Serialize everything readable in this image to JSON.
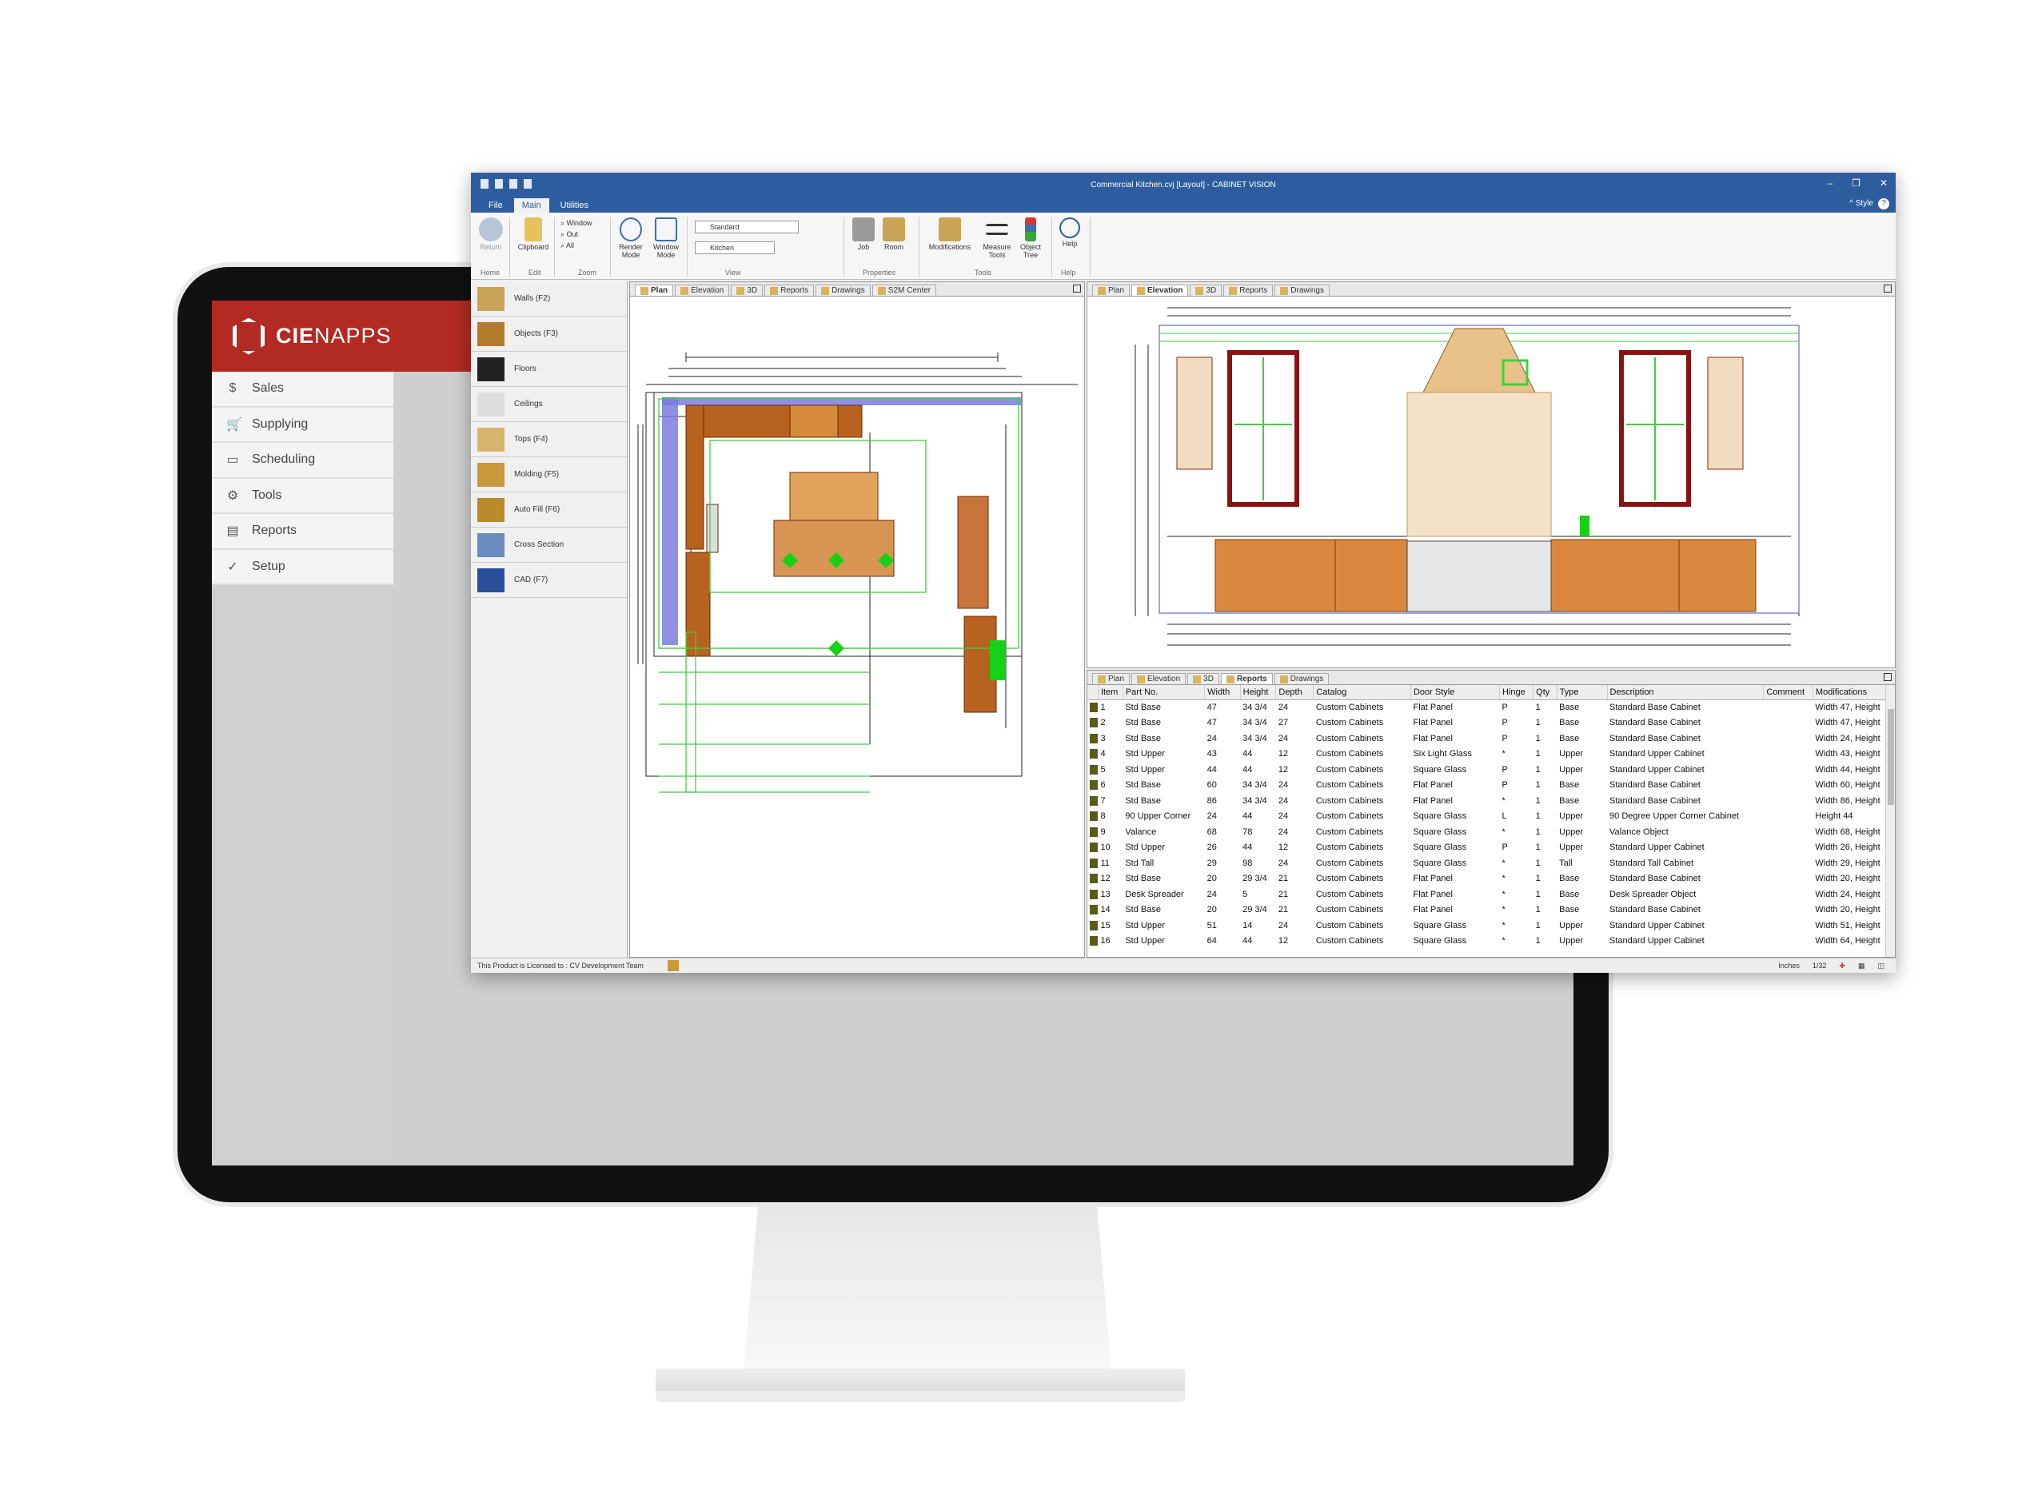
{
  "cienapps": {
    "brand_bold": "CIE",
    "brand_light": "NAPPS",
    "menu": [
      {
        "label": "Sales",
        "icon": "dollar-icon"
      },
      {
        "label": "Supplying",
        "icon": "cart-icon"
      },
      {
        "label": "Scheduling",
        "icon": "monitor-icon"
      },
      {
        "label": "Tools",
        "icon": "gear-icon"
      },
      {
        "label": "Reports",
        "icon": "document-icon"
      },
      {
        "label": "Setup",
        "icon": "check-circle-icon"
      }
    ]
  },
  "window": {
    "title": "Commercial Kitchen.cvj [Layout] - CABINET VISION",
    "menu": [
      "File",
      "Main",
      "Utilities"
    ],
    "active_menu": "Main",
    "style_label": "Style",
    "help_label": "?"
  },
  "ribbon": {
    "return_label": "Return",
    "clipboard_label": "Clipboard",
    "zoom_window": "Window",
    "zoom_out": "Out",
    "zoom_all": "All",
    "render_mode": "Render Mode",
    "window_mode": "Window Mode",
    "view_select": "Standard",
    "room_select": "Kitchen",
    "job_label": "Job",
    "room_label": "Room",
    "modifications_label": "Modifications",
    "measure_tools_label": "Measure Tools",
    "object_tree_label": "Object Tree",
    "help_label": "Help",
    "groups": {
      "home": "Home",
      "edit": "Edit",
      "zoom": "Zoom",
      "view": "View",
      "properties": "Properties",
      "tools": "Tools",
      "help": "Help"
    }
  },
  "left_panel": [
    {
      "label": "Walls (F2)",
      "color": "#c9a356"
    },
    {
      "label": "Objects (F3)",
      "color": "#b27a2a"
    },
    {
      "label": "Floors",
      "color": "#222222"
    },
    {
      "label": "Ceilings",
      "color": "#dddddd"
    },
    {
      "label": "Tops (F4)",
      "color": "#d8b46c"
    },
    {
      "label": "Molding (F5)",
      "color": "#c99a3c"
    },
    {
      "label": "Auto Fill (F6)",
      "color": "#b88a2a"
    },
    {
      "label": "Cross Section",
      "color": "#6a8cbf"
    },
    {
      "label": "CAD (F7)",
      "color": "#2a4f9a"
    }
  ],
  "plan_tabs": [
    "Plan",
    "Elevation",
    "3D",
    "Reports",
    "Drawings",
    "S2M Center"
  ],
  "elev_tabs": [
    "Plan",
    "Elevation",
    "3D",
    "Reports",
    "Drawings"
  ],
  "report_tabs": [
    "Plan",
    "Elevation",
    "3D",
    "Reports",
    "Drawings"
  ],
  "report": {
    "columns": [
      "Item",
      "Part No.",
      "Width",
      "Height",
      "Depth",
      "Catalog",
      "Door Style",
      "Hinge",
      "Qty",
      "Type",
      "Description",
      "Comment",
      "Modifications"
    ],
    "rows": [
      [
        "1",
        "Std Base",
        "47",
        "34 3/4",
        "24",
        "Custom Cabinets",
        "Flat Panel",
        "P",
        "1",
        "Base",
        "Standard Base Cabinet",
        "",
        "Width 47, Height"
      ],
      [
        "2",
        "Std Base",
        "47",
        "34 3/4",
        "27",
        "Custom Cabinets",
        "Flat Panel",
        "P",
        "1",
        "Base",
        "Standard Base Cabinet",
        "",
        "Width 47, Height"
      ],
      [
        "3",
        "Std Base",
        "24",
        "34 3/4",
        "24",
        "Custom Cabinets",
        "Flat Panel",
        "P",
        "1",
        "Base",
        "Standard Base Cabinet",
        "",
        "Width 24, Height"
      ],
      [
        "4",
        "Std Upper",
        "43",
        "44",
        "12",
        "Custom Cabinets",
        "Six Light Glass",
        "*",
        "1",
        "Upper",
        "Standard Upper Cabinet",
        "",
        "Width 43, Height"
      ],
      [
        "5",
        "Std Upper",
        "44",
        "44",
        "12",
        "Custom Cabinets",
        "Square Glass",
        "P",
        "1",
        "Upper",
        "Standard Upper Cabinet",
        "",
        "Width 44, Height"
      ],
      [
        "6",
        "Std Base",
        "60",
        "34 3/4",
        "24",
        "Custom Cabinets",
        "Flat Panel",
        "P",
        "1",
        "Base",
        "Standard Base Cabinet",
        "",
        "Width 60, Height"
      ],
      [
        "7",
        "Std Base",
        "86",
        "34 3/4",
        "24",
        "Custom Cabinets",
        "Flat Panel",
        "*",
        "1",
        "Base",
        "Standard Base Cabinet",
        "",
        "Width 86, Height"
      ],
      [
        "8",
        "90 Upper Corner",
        "24",
        "44",
        "24",
        "Custom Cabinets",
        "Square Glass",
        "L",
        "1",
        "Upper",
        "90 Degree Upper Corner Cabinet",
        "",
        "Height 44"
      ],
      [
        "9",
        "Valance",
        "68",
        "78",
        "24",
        "Custom Cabinets",
        "Square Glass",
        "*",
        "1",
        "Upper",
        "Valance Object",
        "",
        "Width 68, Height"
      ],
      [
        "10",
        "Std Upper",
        "26",
        "44",
        "12",
        "Custom Cabinets",
        "Square Glass",
        "P",
        "1",
        "Upper",
        "Standard Upper Cabinet",
        "",
        "Width 26, Height"
      ],
      [
        "11",
        "Std Tall",
        "29",
        "98",
        "24",
        "Custom Cabinets",
        "Square Glass",
        "*",
        "1",
        "Tall",
        "Standard Tall Cabinet",
        "",
        "Width 29, Height"
      ],
      [
        "12",
        "Std Base",
        "20",
        "29 3/4",
        "21",
        "Custom Cabinets",
        "Flat Panel",
        "*",
        "1",
        "Base",
        "Standard Base Cabinet",
        "",
        "Width 20, Height"
      ],
      [
        "13",
        "Desk Spreader",
        "24",
        "5",
        "21",
        "Custom Cabinets",
        "Flat Panel",
        "*",
        "1",
        "Base",
        "Desk Spreader Object",
        "",
        "Width 24, Height"
      ],
      [
        "14",
        "Std Base",
        "20",
        "29 3/4",
        "21",
        "Custom Cabinets",
        "Flat Panel",
        "*",
        "1",
        "Base",
        "Standard Base Cabinet",
        "",
        "Width 20, Height"
      ],
      [
        "15",
        "Std Upper",
        "51",
        "14",
        "24",
        "Custom Cabinets",
        "Square Glass",
        "*",
        "1",
        "Upper",
        "Standard Upper Cabinet",
        "",
        "Width 51, Height"
      ],
      [
        "16",
        "Std Upper",
        "64",
        "44",
        "12",
        "Custom Cabinets",
        "Square Glass",
        "*",
        "1",
        "Upper",
        "Standard Upper Cabinet",
        "",
        "Width 64, Height"
      ]
    ]
  },
  "status": {
    "license": "This Product is Licensed to : CV Development Team",
    "units": "Inches",
    "scale": "1/32"
  }
}
